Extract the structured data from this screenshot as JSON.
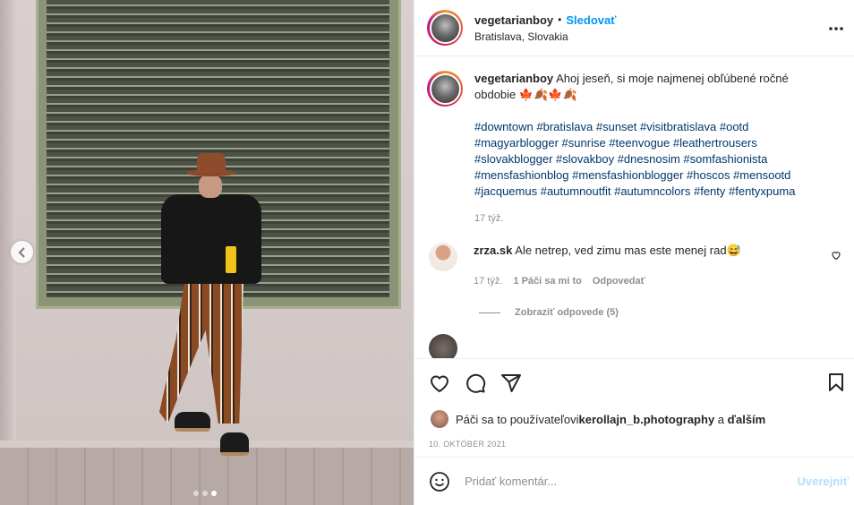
{
  "post": {
    "username": "vegetarianboy",
    "separator": "•",
    "follow_label": "Sledovať",
    "location": "Bratislava, Slovakia",
    "more_icon": "more-horizontal-icon"
  },
  "photo": {
    "carousel_count": 3,
    "active_index": 2,
    "prev_icon": "chevron-left-icon"
  },
  "caption": {
    "username": "vegetarianboy",
    "text": "Ahoj jeseň, si moje najmenej obľúbené ročné obdobie 🍁🍂🍁🍂",
    "hashtags": "#downtown #bratislava #sunset #visitbratislava #ootd #magyarblogger #sunrise #teenvogue #leathertrousers #slovakblogger #slovakboy #dnesnosim #somfashionista #mensfashionblog #mensfashionblogger #hoscos #mensootd #jacquemus #autumnoutfit #autumncolors #fenty #fentyxpuma",
    "time": "17 týž."
  },
  "comments": [
    {
      "username": "zrza.sk",
      "text": "Ale netrep, ved zimu mas este menej rad😅",
      "time": "17 týž.",
      "likes": "1 Páči sa mi to",
      "reply_label": "Odpovedať",
      "view_replies": "Zobraziť odpovede (5)"
    }
  ],
  "actions": {
    "like_icon": "heart-icon",
    "comment_icon": "comment-icon",
    "share_icon": "share-icon",
    "save_icon": "bookmark-icon"
  },
  "likes": {
    "prefix": "Páči sa to používateľovi ",
    "user": "kerollajn_b.photography",
    "suffix": " a ",
    "others": "ďalším"
  },
  "date": "10. OKTÓBER 2021",
  "add_comment": {
    "placeholder": "Pridať komentár...",
    "publish_label": "Uverejniť",
    "emoji_icon": "emoji-icon"
  },
  "colors": {
    "link": "#00376b",
    "follow": "#0095f6",
    "muted": "#8e8e8e",
    "publish_disabled": "#b2dffc"
  }
}
